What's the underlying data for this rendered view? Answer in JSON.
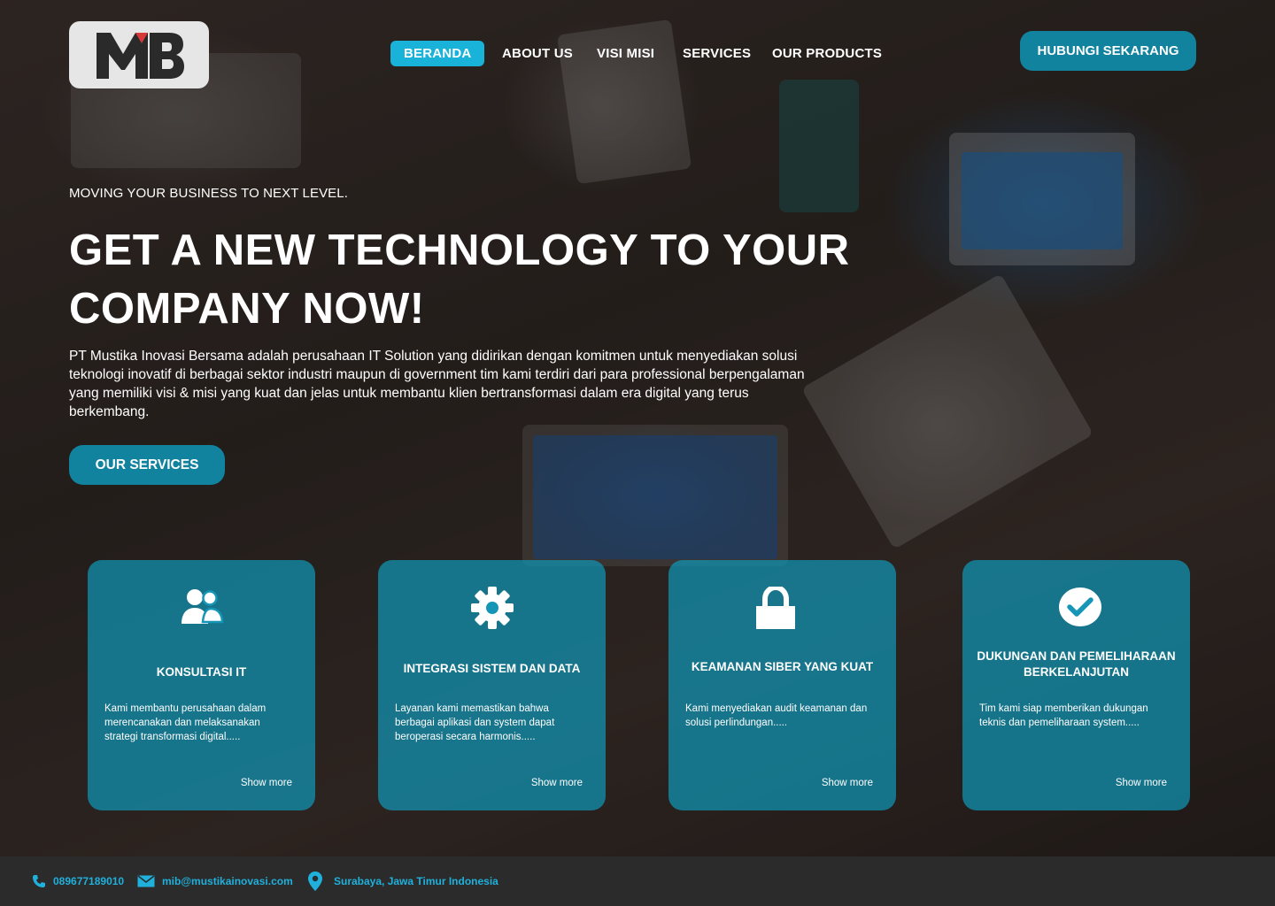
{
  "brand": {
    "logo_text": "MB",
    "accent": "#19b2d8",
    "button_color": "#11839f"
  },
  "nav": {
    "items": [
      {
        "label": "BERANDA",
        "active": true
      },
      {
        "label": "ABOUT US",
        "active": false
      },
      {
        "label": "VISI MISI",
        "active": false
      },
      {
        "label": "SERVICES",
        "active": false
      },
      {
        "label": "OUR PRODUCTS",
        "active": false
      }
    ],
    "cta_label": "HUBUNGI SEKARANG"
  },
  "hero": {
    "tagline": "MOVING YOUR BUSINESS TO NEXT LEVEL.",
    "headline": "GET A NEW TECHNOLOGY TO YOUR COMPANY NOW!",
    "description": "PT Mustika Inovasi Bersama adalah perusahaan IT Solution yang didirikan dengan komitmen untuk menyediakan solusi teknologi inovatif di berbagai sektor industri maupun di government tim kami terdiri dari  para professional berpengalaman yang memiliki visi & misi yang kuat dan jelas untuk membantu klien bertransformasi dalam era digital yang terus berkembang.",
    "cta_label": "OUR SERVICES"
  },
  "services": [
    {
      "icon": "users-icon",
      "title": "KONSULTASI IT",
      "text": "Kami membantu perusahaan dalam merencanakan dan melaksanakan strategi transformasi digital.....",
      "more": "Show more"
    },
    {
      "icon": "gear-icon",
      "title": "INTEGRASI SISTEM DAN DATA",
      "text": "Layanan kami memastikan bahwa berbagai aplikasi dan system dapat beroperasi secara harmonis.....",
      "more": "Show more"
    },
    {
      "icon": "lock-icon",
      "title": "KEAMANAN SIBER YANG KUAT",
      "text": "Kami menyediakan audit keamanan dan solusi perlindungan.....",
      "more": "Show more"
    },
    {
      "icon": "check-circle-icon",
      "title": "DUKUNGAN DAN PEMELIHARAAN BERKELANJUTAN",
      "text": "Tim  kami  siap  memberikan dukungan teknis dan pemeliharaan system.....",
      "more": "Show more"
    }
  ],
  "footer": {
    "phone": "089677189010",
    "email": "mib@mustikainovasi.com",
    "location": "Surabaya, Jawa Timur Indonesia"
  }
}
